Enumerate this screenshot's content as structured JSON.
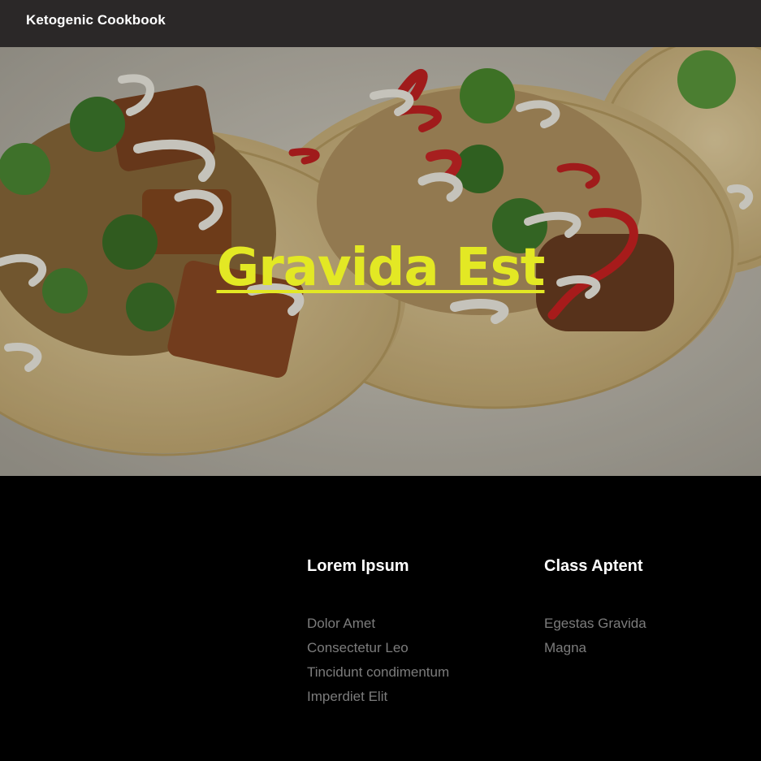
{
  "header": {
    "brand": "Ketogenic Cookbook"
  },
  "hero": {
    "title": "Gravida Est",
    "image": "tacos-photo",
    "title_color": "#e3e824"
  },
  "footer": {
    "columns": [
      {
        "heading": "Lorem Ipsum",
        "links": [
          "Dolor Amet",
          "Consectetur Leo",
          "Tincidunt condimentum",
          "Imperdiet Elit"
        ]
      },
      {
        "heading": "Class Aptent",
        "links": [
          "Egestas Gravida",
          "Magna"
        ]
      }
    ]
  },
  "colors": {
    "topbar_bg": "#2b2828",
    "footer_bg": "#000000",
    "link": "#7c7c7c"
  }
}
